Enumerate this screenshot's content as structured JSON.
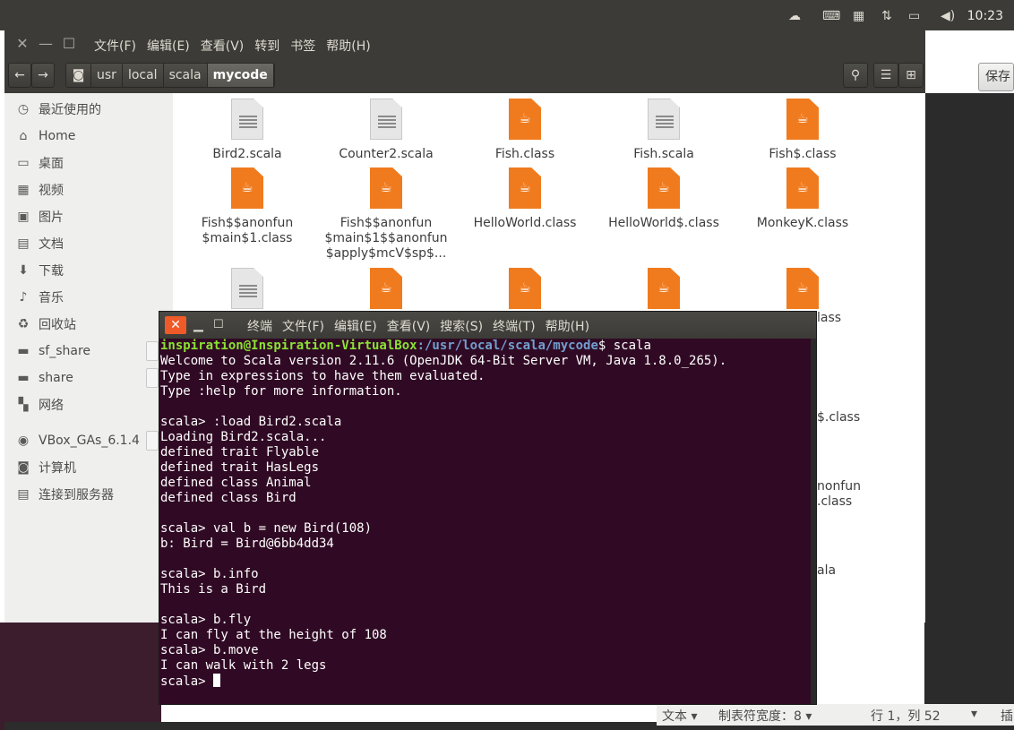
{
  "top_panel": {
    "clock": "10:23",
    "icons": [
      "weather-icon",
      "keyboard-icon",
      "calendar-icon",
      "network-icon",
      "battery-icon",
      "volume-icon"
    ]
  },
  "file_manager": {
    "menu": [
      "文件(F)",
      "编辑(E)",
      "查看(V)",
      "转到",
      "书签",
      "帮助(H)"
    ],
    "breadcrumb": [
      "usr",
      "local",
      "scala",
      "mycode"
    ],
    "sidebar": [
      {
        "label": "最近使用的",
        "icon": "clock-icon"
      },
      {
        "label": "Home",
        "icon": "home-icon"
      },
      {
        "label": "桌面",
        "icon": "desktop-icon"
      },
      {
        "label": "视频",
        "icon": "video-icon"
      },
      {
        "label": "图片",
        "icon": "picture-icon"
      },
      {
        "label": "文档",
        "icon": "document-icon"
      },
      {
        "label": "下载",
        "icon": "download-icon"
      },
      {
        "label": "音乐",
        "icon": "music-icon"
      },
      {
        "label": "回收站",
        "icon": "trash-icon"
      },
      {
        "label": "sf_share",
        "icon": "drive-icon"
      },
      {
        "label": "share",
        "icon": "drive-icon"
      },
      {
        "label": "网络",
        "icon": "network-icon"
      },
      {
        "label": "VBox_GAs_6.1.4",
        "icon": "disc-icon"
      },
      {
        "label": "计算机",
        "icon": "computer-icon"
      },
      {
        "label": "连接到服务器",
        "icon": "server-icon"
      }
    ],
    "files": [
      {
        "name": "Bird2.scala",
        "type": "text"
      },
      {
        "name": "Counter2.scala",
        "type": "text"
      },
      {
        "name": "Fish.class",
        "type": "java"
      },
      {
        "name": "Fish.scala",
        "type": "text"
      },
      {
        "name": "Fish$.class",
        "type": "java"
      },
      {
        "name": "Fish$$anonfun\n$main$1.class",
        "type": "java"
      },
      {
        "name": "Fish$$anonfun\n$main$1$$anonfun\n$apply$mcV$sp$...",
        "type": "java"
      },
      {
        "name": "HelloWorld.class",
        "type": "java"
      },
      {
        "name": "HelloWorld$.class",
        "type": "java"
      },
      {
        "name": "MonkeyK.class",
        "type": "java"
      },
      {
        "name": "",
        "type": "text"
      },
      {
        "name": "",
        "type": "java"
      },
      {
        "name": "",
        "type": "java"
      },
      {
        "name": "",
        "type": "java"
      },
      {
        "name": "",
        "type": "java"
      }
    ],
    "peek_labels": [
      "lass",
      "$.class",
      "nonfun",
      ".class",
      "ala"
    ]
  },
  "terminal": {
    "menu": [
      "终端",
      "文件(F)",
      "编辑(E)",
      "查看(V)",
      "搜索(S)",
      "终端(T)",
      "帮助(H)"
    ],
    "prompt_user": "inspiration@Inspiration-VirtualBox",
    "prompt_path": ":/usr/local/scala/mycode",
    "prompt_cmd": "$ scala",
    "lines": [
      "Welcome to Scala version 2.11.6 (OpenJDK 64-Bit Server VM, Java 1.8.0_265).",
      "Type in expressions to have them evaluated.",
      "Type :help for more information.",
      "",
      "scala> :load Bird2.scala",
      "Loading Bird2.scala...",
      "defined trait Flyable",
      "defined trait HasLegs",
      "defined class Animal",
      "defined class Bird",
      "",
      "scala> val b = new Bird(108)",
      "b: Bird = Bird@6bb4dd34",
      "",
      "scala> b.info",
      "This is a Bird",
      "",
      "scala> b.fly",
      "I can fly at the height of 108",
      "scala> b.move",
      "I can walk with 2 legs"
    ],
    "last_prompt": "scala> "
  },
  "gedit": {
    "save_label": "保存",
    "status_mode": "文本 ▾",
    "status_tab": "制表符宽度：8 ▾",
    "status_pos": "行 1，列 52",
    "status_dropdown": "▾",
    "status_insert": "插"
  }
}
